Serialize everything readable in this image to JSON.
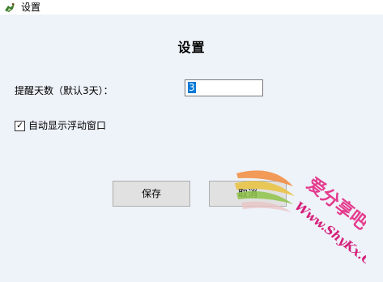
{
  "window": {
    "title": "设置",
    "icon": "app-icon-bird"
  },
  "dialog": {
    "heading": "设置",
    "remind_days_label": "提醒天数（默认3天）：",
    "remind_days_value": "3",
    "auto_show_label": "自动显示浮动窗口",
    "auto_show_checked": true,
    "save_label": "保存",
    "cancel_label": "取消"
  },
  "watermark": {
    "brand": "爱分享吧",
    "url": "Www.ShyKx.Com"
  }
}
